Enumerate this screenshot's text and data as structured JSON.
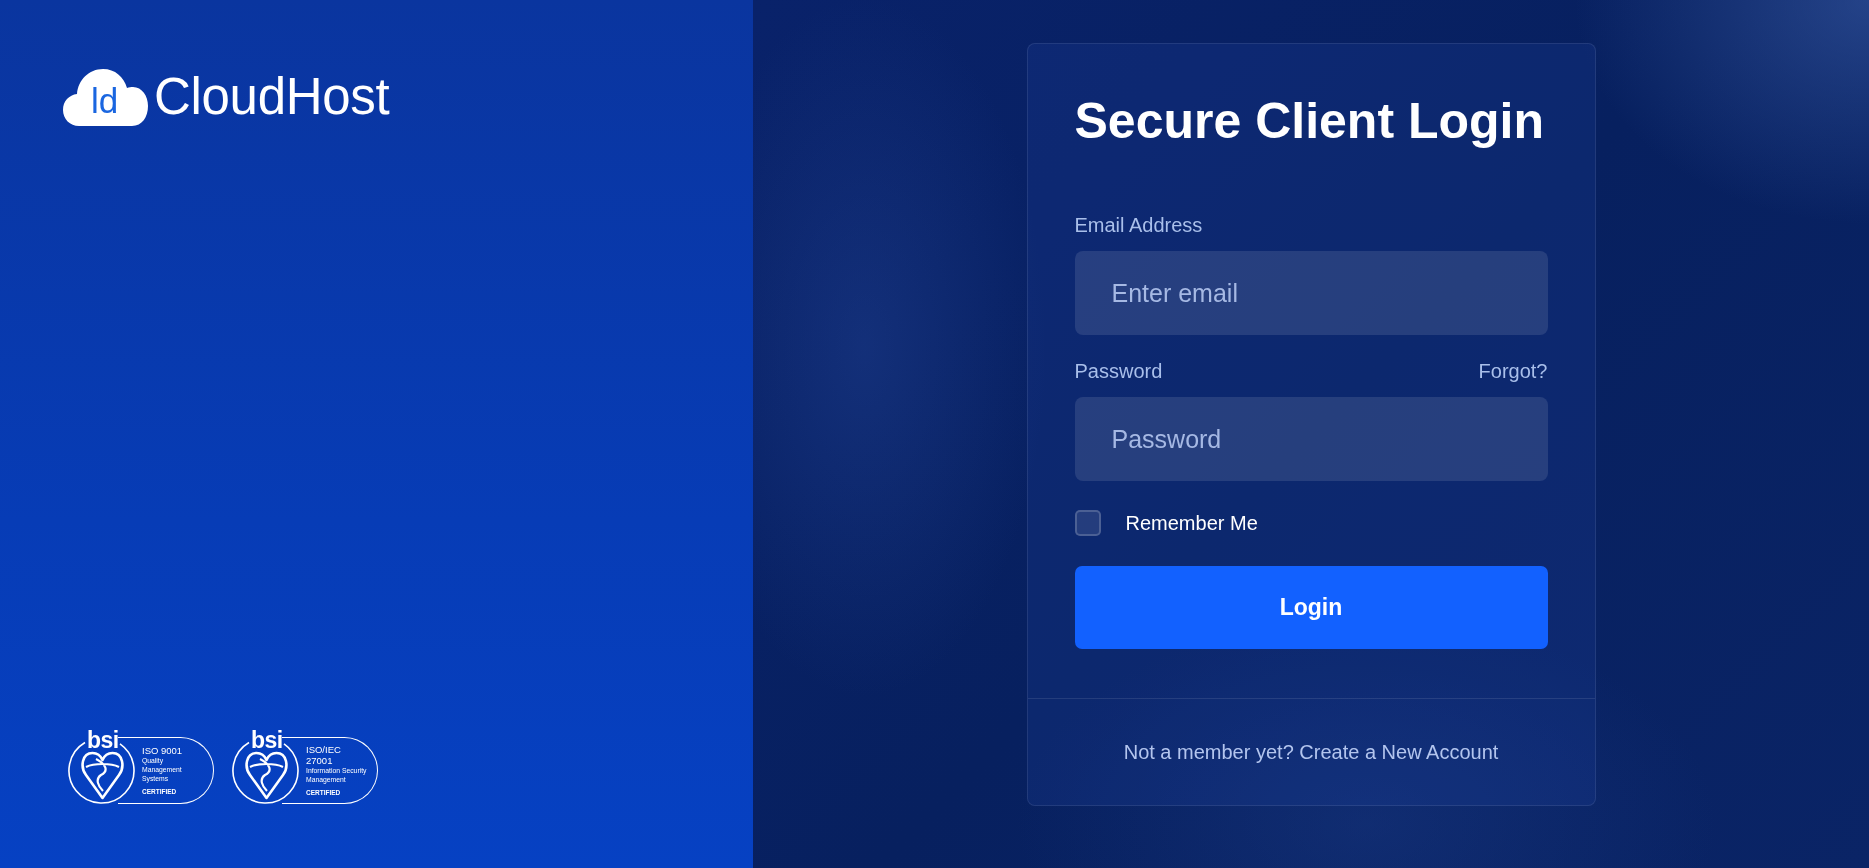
{
  "brand": {
    "initials": "ld",
    "name": "CloudHost"
  },
  "certifications": [
    {
      "issuer": "bsi",
      "standard": [
        "ISO 9001"
      ],
      "description": [
        "Quality",
        "Management",
        "Systems"
      ],
      "status": "CERTIFIED"
    },
    {
      "issuer": "bsi",
      "standard": [
        "ISO/IEC",
        "27001"
      ],
      "description": [
        "Information Security",
        "Management"
      ],
      "status": "CERTIFIED"
    }
  ],
  "login": {
    "title": "Secure Client Login",
    "fields": [
      {
        "label": "Email Address",
        "placeholder": "Enter email"
      },
      {
        "label": "Password",
        "link": "Forgot?",
        "placeholder": "Password"
      }
    ],
    "remember": {
      "label": "Remember Me",
      "checked": false
    },
    "submit": "Login",
    "footer": {
      "text": "Not a member yet?",
      "link": "Create a New Account"
    }
  }
}
